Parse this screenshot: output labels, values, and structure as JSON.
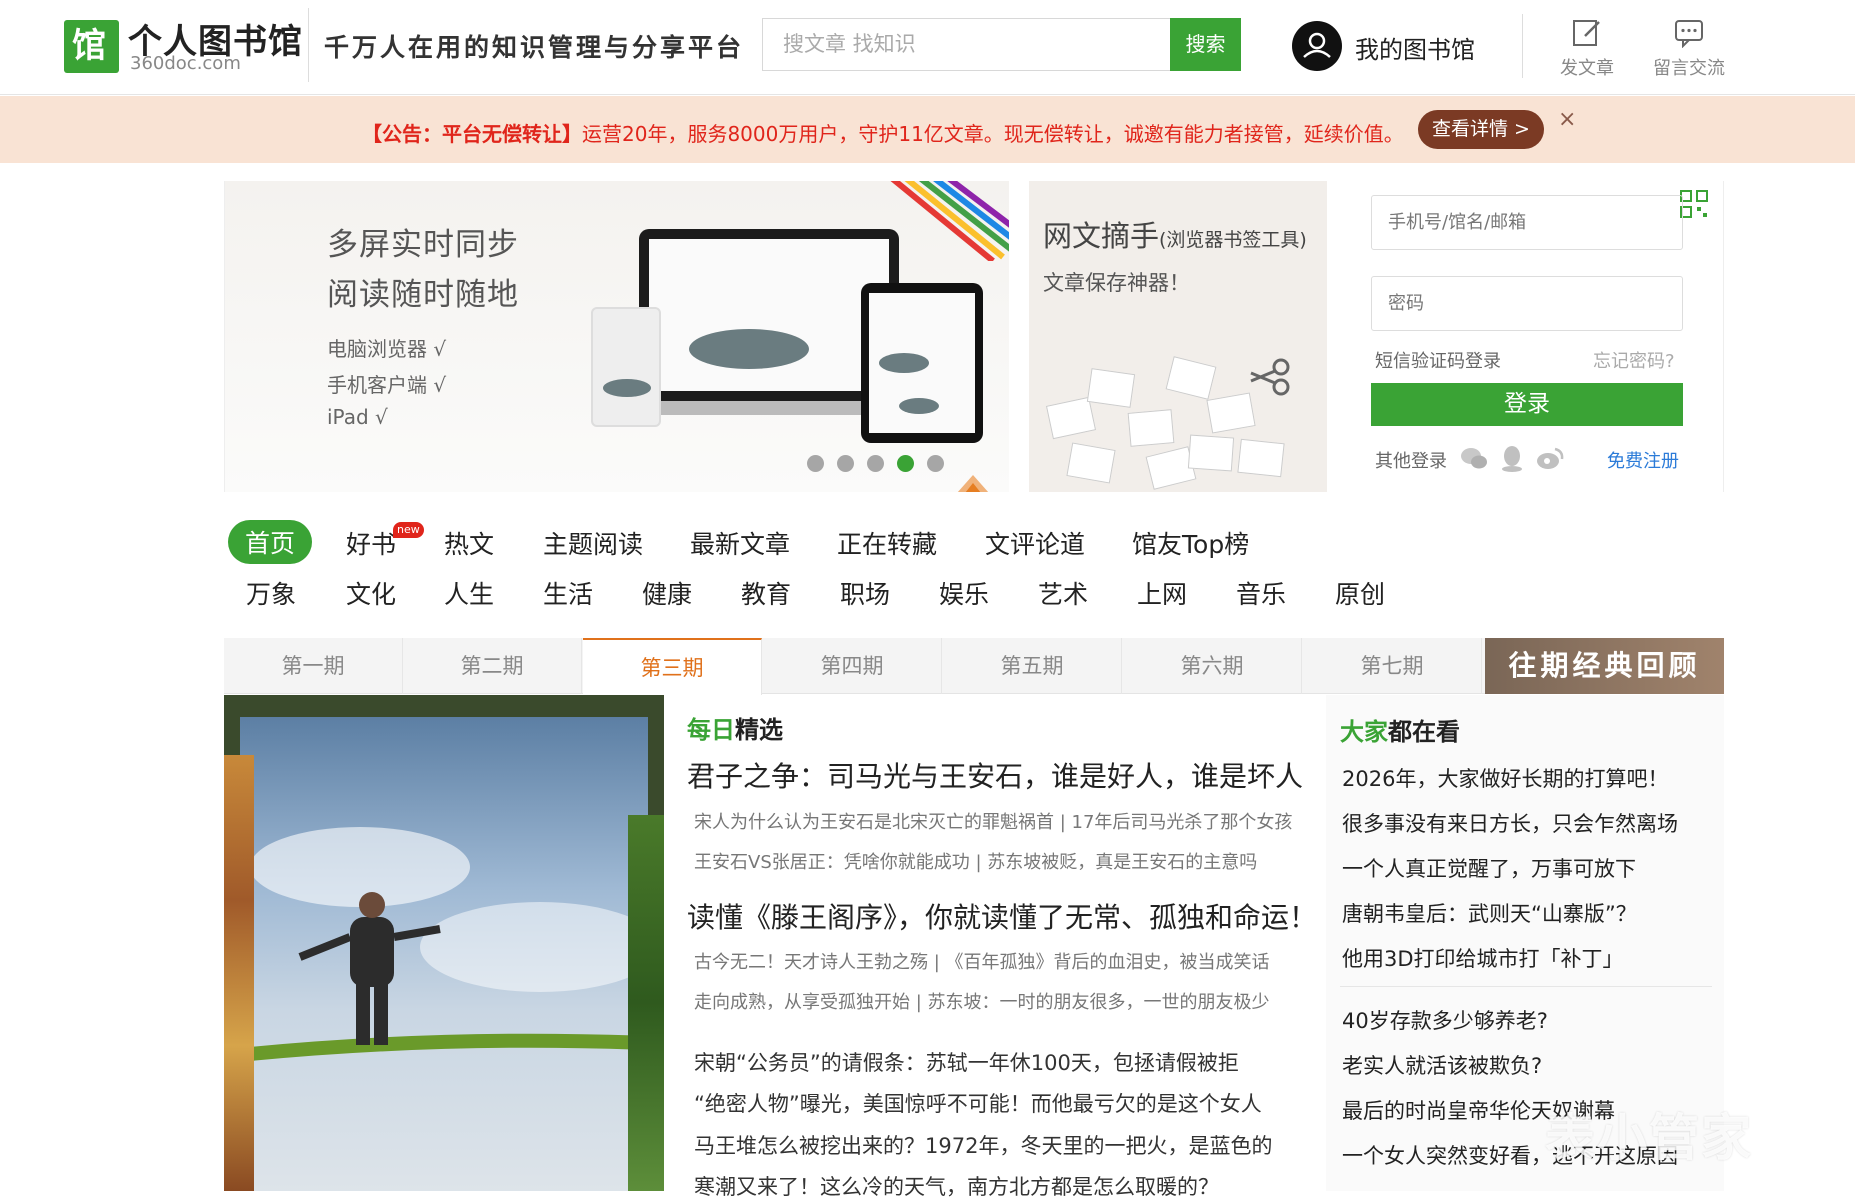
{
  "header": {
    "logo_icon": "馆",
    "logo_title": "个人图书馆",
    "logo_sub": "360doc.com",
    "slogan": "千万人在用的知识管理与分享平台",
    "search_placeholder": "搜文章 找知识",
    "search_button": "搜索",
    "my_library": "我的图书馆",
    "post_article": "发文章",
    "message": "留言交流"
  },
  "notice": {
    "prefix": "【公告：平台无偿转让】",
    "text": "运营20年，服务8000万用户，守护11亿文章。现无偿转让，诚邀有能力者接管，延续价值。",
    "button": "查看详情 >",
    "close": "×"
  },
  "banner": {
    "line1": "多屏实时同步",
    "line2": "阅读随时随地",
    "features": [
      "电脑浏览器 √",
      "手机客户端 √",
      "iPad √"
    ],
    "active_dot": 3,
    "dot_count": 5
  },
  "bookmarklet": {
    "title": "网文摘手",
    "title_small": "(浏览器书签工具)",
    "subtitle": "文章保存神器！"
  },
  "login": {
    "username_placeholder": "手机号/馆名/邮箱",
    "password_placeholder": "密码",
    "sms_login": "短信验证码登录",
    "forgot": "忘记密码?",
    "login_button": "登录",
    "other_login": "其他登录",
    "register": "免费注册"
  },
  "nav": {
    "row1": [
      "首页",
      "好书",
      "热文",
      "主题阅读",
      "最新文章",
      "正在转藏",
      "文评论道",
      "馆友Top榜"
    ],
    "new_badge": "new",
    "row2": [
      "万象",
      "文化",
      "人生",
      "生活",
      "健康",
      "教育",
      "职场",
      "娱乐",
      "艺术",
      "上网",
      "音乐",
      "原创"
    ]
  },
  "tabs": {
    "items": [
      "第一期",
      "第二期",
      "第三期",
      "第四期",
      "第五期",
      "第六期",
      "第七期"
    ],
    "active_index": 2,
    "review": "往期经典回顾"
  },
  "daily": {
    "label_green": "每日",
    "label_black": "精选",
    "articles": [
      {
        "title": "君子之争：司马光与王安石，谁是好人，谁是坏人",
        "lines": [
          "宋人为什么认为王安石是北宋灭亡的罪魁祸首 | 17年后司马光杀了那个女孩",
          "王安石VS张居正：凭啥你就能成功 |  苏东坡被贬，真是王安石的主意吗"
        ]
      },
      {
        "title": "读懂《滕王阁序》，你就读懂了无常、孤独和命运！",
        "lines": [
          "古今无二！天才诗人王勃之殇 |  《百年孤独》背后的血泪史，被当成笑话",
          "走向成熟，从享受孤独开始 |  苏东坡：一时的朋友很多，一世的朋友极少"
        ]
      }
    ],
    "more": [
      "宋朝“公务员”的请假条：苏轼一年休100天，包拯请假被拒",
      "“绝密人物”曝光，美国惊呼不可能！而他最亏欠的是这个女人",
      "马王堆怎么被挖出来的？1972年，冬天里的一把火，是蓝色的",
      "寒潮又来了！这么冷的天气，南方北方都是怎么取暖的？"
    ]
  },
  "sidebar": {
    "label_green": "大家",
    "label_black": "都在看",
    "group1": [
      "2026年，大家做好长期的打算吧！",
      "很多事没有来日方长，只会乍然离场",
      "一个人真正觉醒了，万事可放下",
      "唐朝韦皇后：武则天“山寨版”？",
      "他用3D打印给城市打「补丁」"
    ],
    "group2": [
      "40岁存款多少够养老?",
      "老实人就活该被欺负?",
      "最后的时尚皇帝华伦天奴谢幕",
      "一个女人突然变好看，逃不开这原因"
    ]
  },
  "watermark": "表小管家",
  "colors": {
    "brand_green": "#3aa335",
    "notice_red": "#e0251b",
    "tab_active": "#e0711b"
  }
}
